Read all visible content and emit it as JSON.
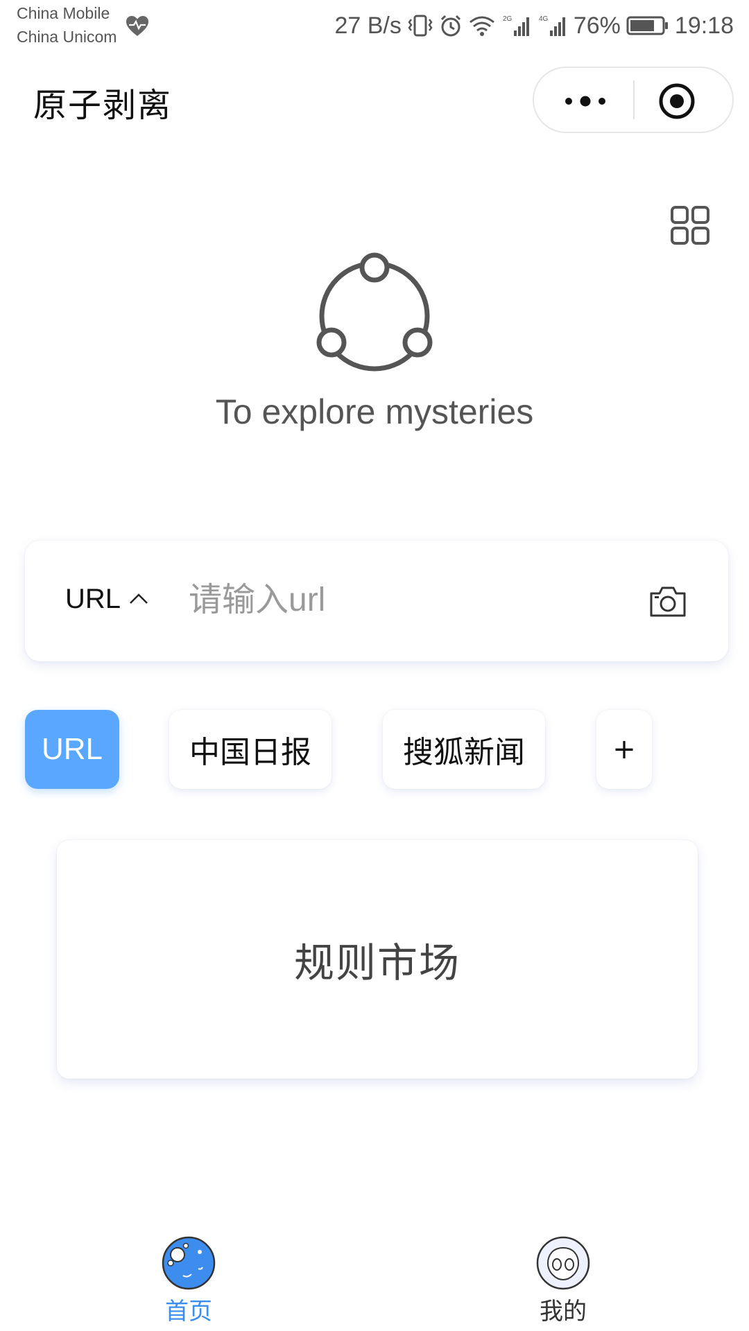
{
  "status_bar": {
    "carrier_1": "China Mobile",
    "carrier_2": "China Unicom",
    "net_speed": "27 B/s",
    "battery": "76%",
    "time": "19:18",
    "icons": [
      "heart-rate-icon",
      "vibrate-icon",
      "alarm-icon",
      "wifi-icon",
      "signal-2g-icon",
      "signal-4g-icon",
      "battery-icon"
    ]
  },
  "header": {
    "title": "原子剥离",
    "capsule": {
      "more_icon": "more-dots-icon",
      "close_icon": "target-icon"
    }
  },
  "toolbar": {
    "grid_icon": "grid-icon"
  },
  "hero": {
    "logo_icon": "share-nodes-icon",
    "tagline": "To explore mysteries"
  },
  "search": {
    "type_label": "URL",
    "type_icon": "chevron-up-icon",
    "input_value": "",
    "placeholder": "请输入url",
    "camera_icon": "camera-icon"
  },
  "sources": {
    "items": [
      {
        "label": "URL",
        "active": true
      },
      {
        "label": "中国日报",
        "active": false
      },
      {
        "label": "搜狐新闻",
        "active": false
      }
    ],
    "add_label": "+"
  },
  "market": {
    "label": "规则市场"
  },
  "tabbar": {
    "items": [
      {
        "label": "首页",
        "icon": "planet-icon",
        "active": true
      },
      {
        "label": "我的",
        "icon": "alien-face-icon",
        "active": false
      }
    ]
  },
  "colors": {
    "accent": "#5aa7ff",
    "tab_active": "#3d8dee",
    "icon_gray": "#555555",
    "background": "#ffffff"
  }
}
